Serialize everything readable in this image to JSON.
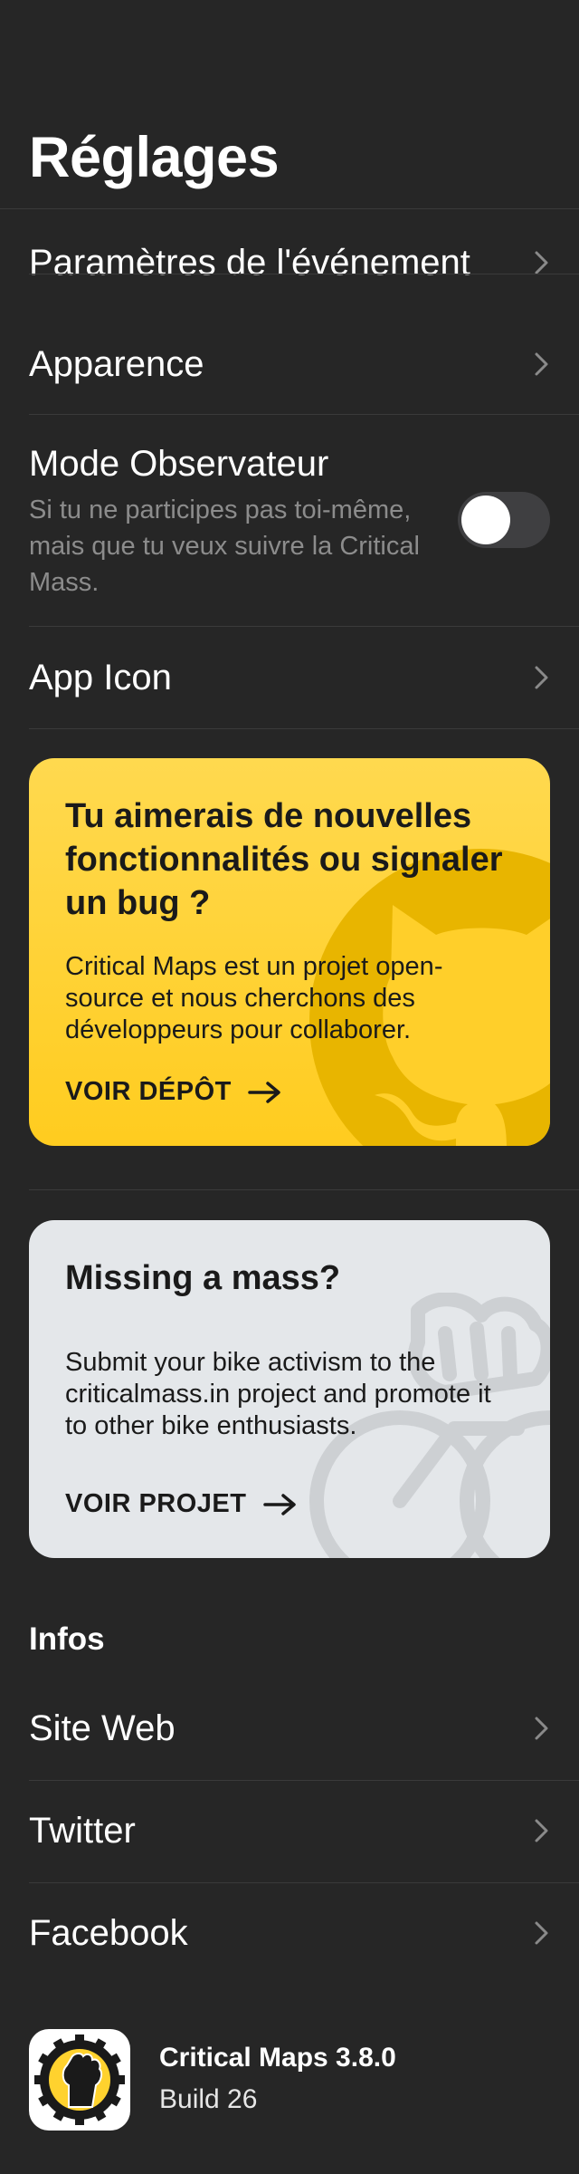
{
  "header": {
    "title": "Réglages"
  },
  "settings": {
    "items": [
      {
        "label": "Paramètres de l'événement"
      },
      {
        "label": "Apparence"
      },
      {
        "label": "App Icon"
      }
    ],
    "observer": {
      "title": "Mode Observateur",
      "description": "Si tu ne participes pas toi-même, mais que tu veux suivre la Critical Mass.",
      "enabled": false
    }
  },
  "cards": {
    "github": {
      "title": "Tu aimerais de nouvelles fonctionnalités ou signaler un bug ?",
      "body": "Critical Maps est un projet open-source et nous cherchons des développeurs pour collaborer.",
      "cta": "VOIR DÉPÔT",
      "background": "#ffd22e",
      "icon": "github-octocat-icon"
    },
    "mass": {
      "title": "Missing a mass?",
      "body": "Submit your bike activism to the criticalmass.in project and promote it to other bike enthusiasts.",
      "cta": "VOIR PROJET",
      "background": "#e4e7ea",
      "icon": "bike-fist-icon"
    }
  },
  "info": {
    "header": "Infos",
    "items": [
      {
        "label": "Site Web"
      },
      {
        "label": "Twitter"
      },
      {
        "label": "Facebook"
      }
    ]
  },
  "footer": {
    "app_name": "Critical Maps 3.8.0",
    "build": "Build 26",
    "icon": "critical-maps-logo"
  },
  "colors": {
    "background": "#262626",
    "divider": "#3a3a3a",
    "secondary_text": "#8c8c8c",
    "accent_yellow": "#ffd22e"
  }
}
